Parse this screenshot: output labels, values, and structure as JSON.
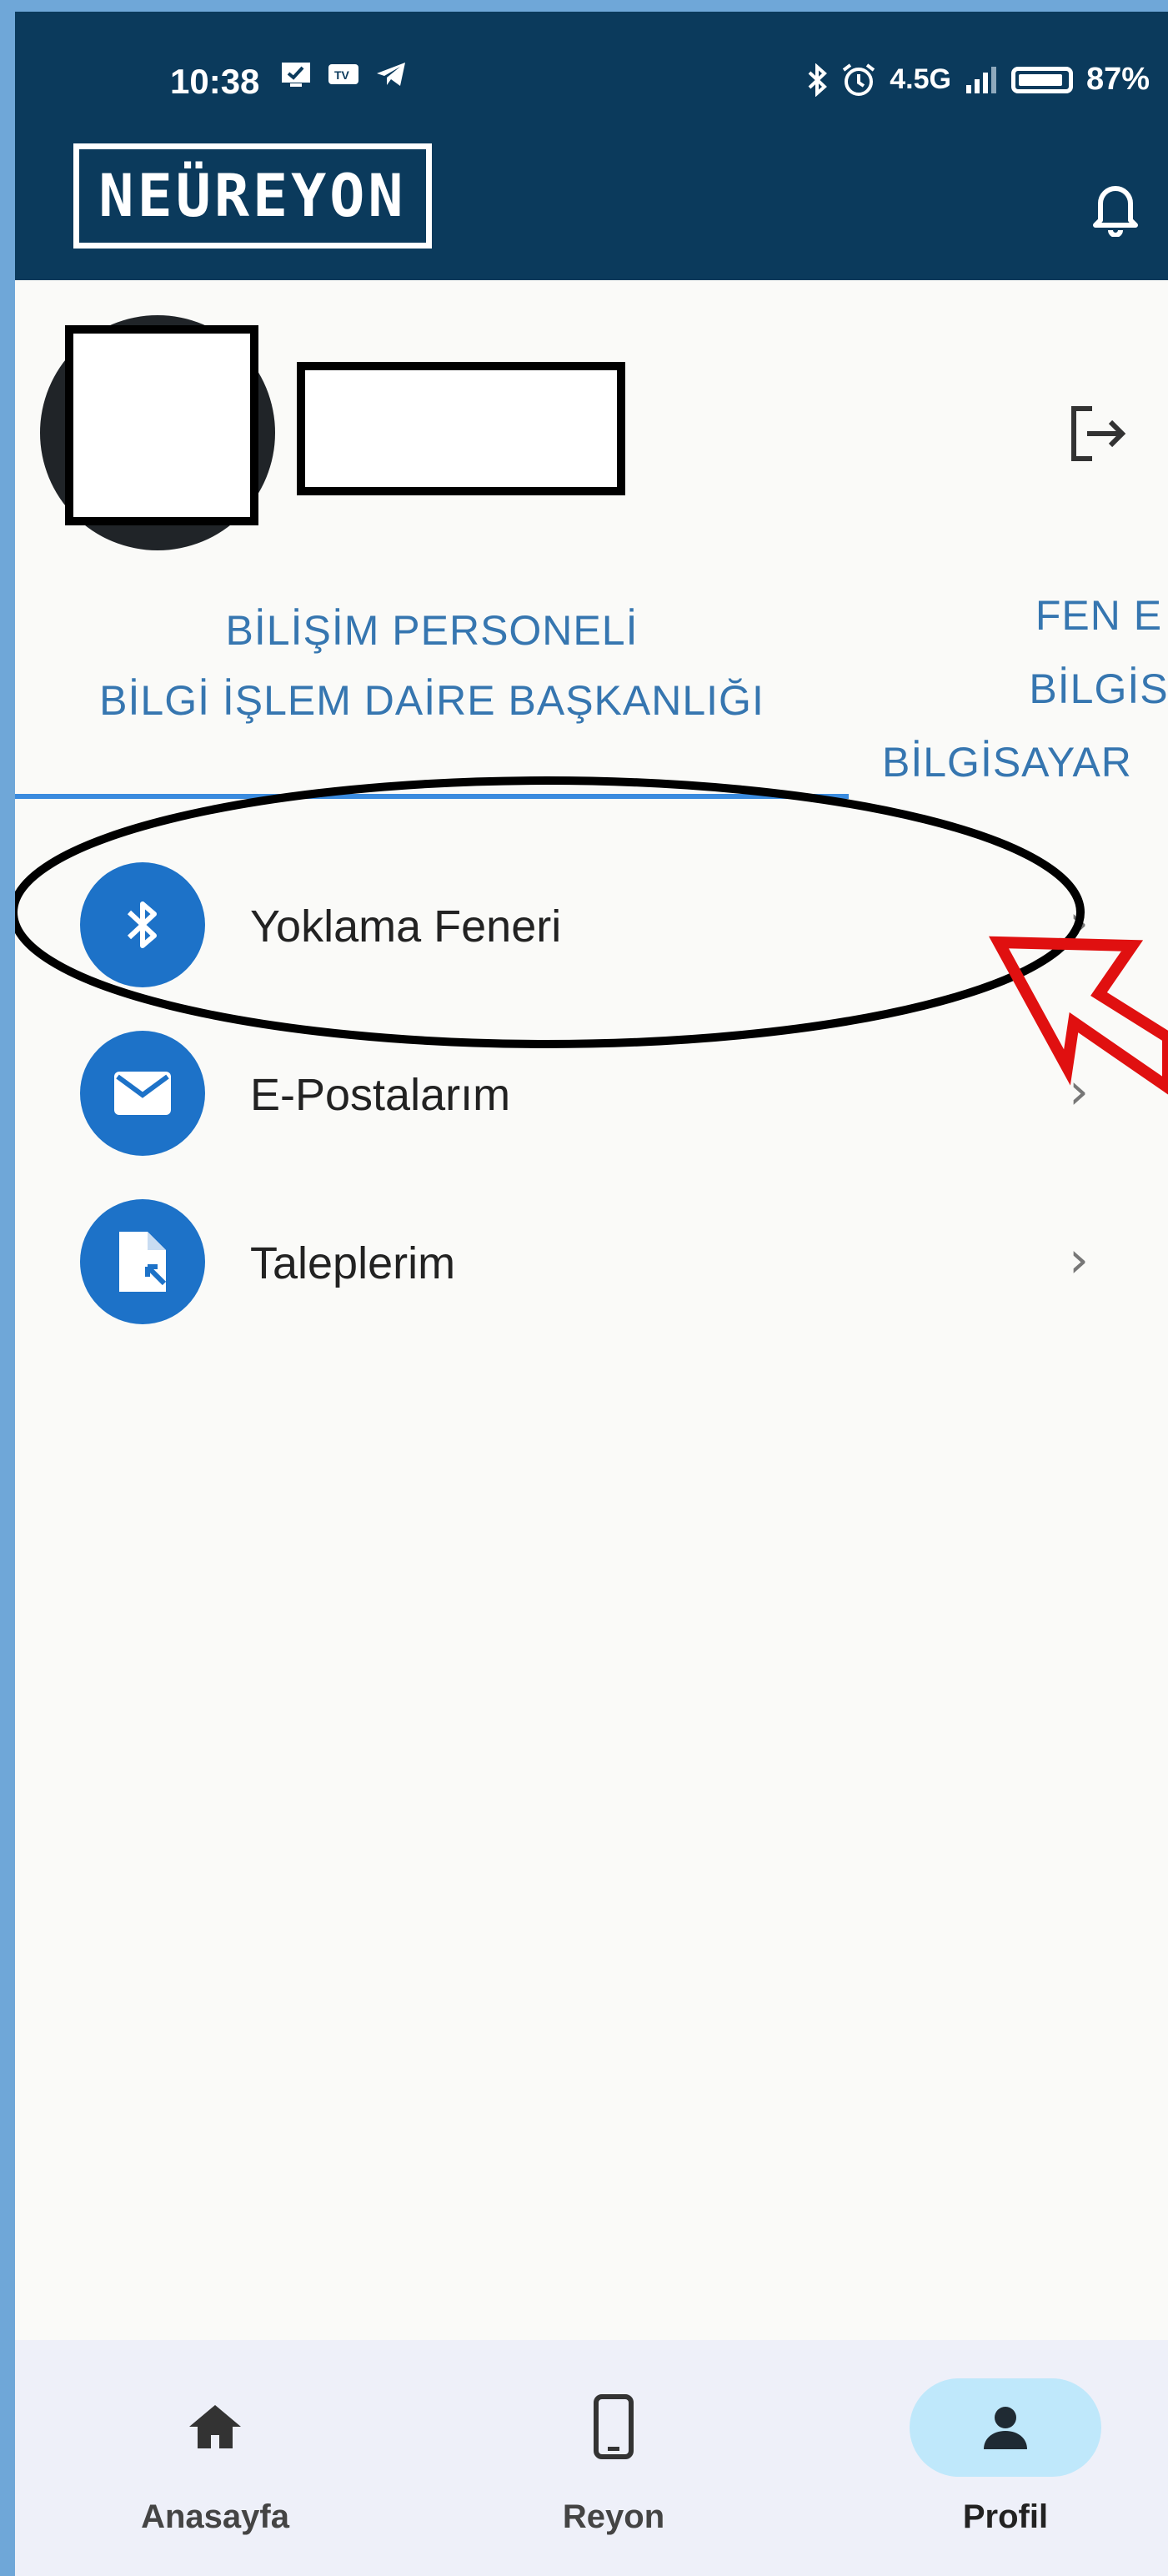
{
  "status_bar": {
    "time": "10:38",
    "network": "4.5G",
    "battery": "87%"
  },
  "header": {
    "logo": "NEÜREYON"
  },
  "profile": {
    "org_tabs": [
      {
        "line1": "BİLİŞİM PERSONELİ",
        "line2": "BİLGİ İŞLEM DAİRE BAŞKANLIĞI"
      },
      {
        "line1": "FEN E",
        "line2": "BİLGİS",
        "line3": "BİLGİSAYAR"
      }
    ]
  },
  "menu": {
    "items": [
      {
        "label": "Yoklama Feneri",
        "icon": "bluetooth-icon"
      },
      {
        "label": "E-Postalarım",
        "icon": "mail-icon"
      },
      {
        "label": "Taleplerim",
        "icon": "request-document-icon"
      }
    ]
  },
  "bottom_nav": {
    "items": [
      {
        "label": "Anasayfa",
        "icon": "home-icon"
      },
      {
        "label": "Reyon",
        "icon": "phone-icon"
      },
      {
        "label": "Profil",
        "icon": "person-icon",
        "active": true
      }
    ]
  },
  "colors": {
    "header_bg": "#0b3a5c",
    "accent_blue": "#1d72c8",
    "tab_text": "#3676b0",
    "nav_active_pill": "#bfe8fb",
    "annotation_red": "#e01010"
  }
}
